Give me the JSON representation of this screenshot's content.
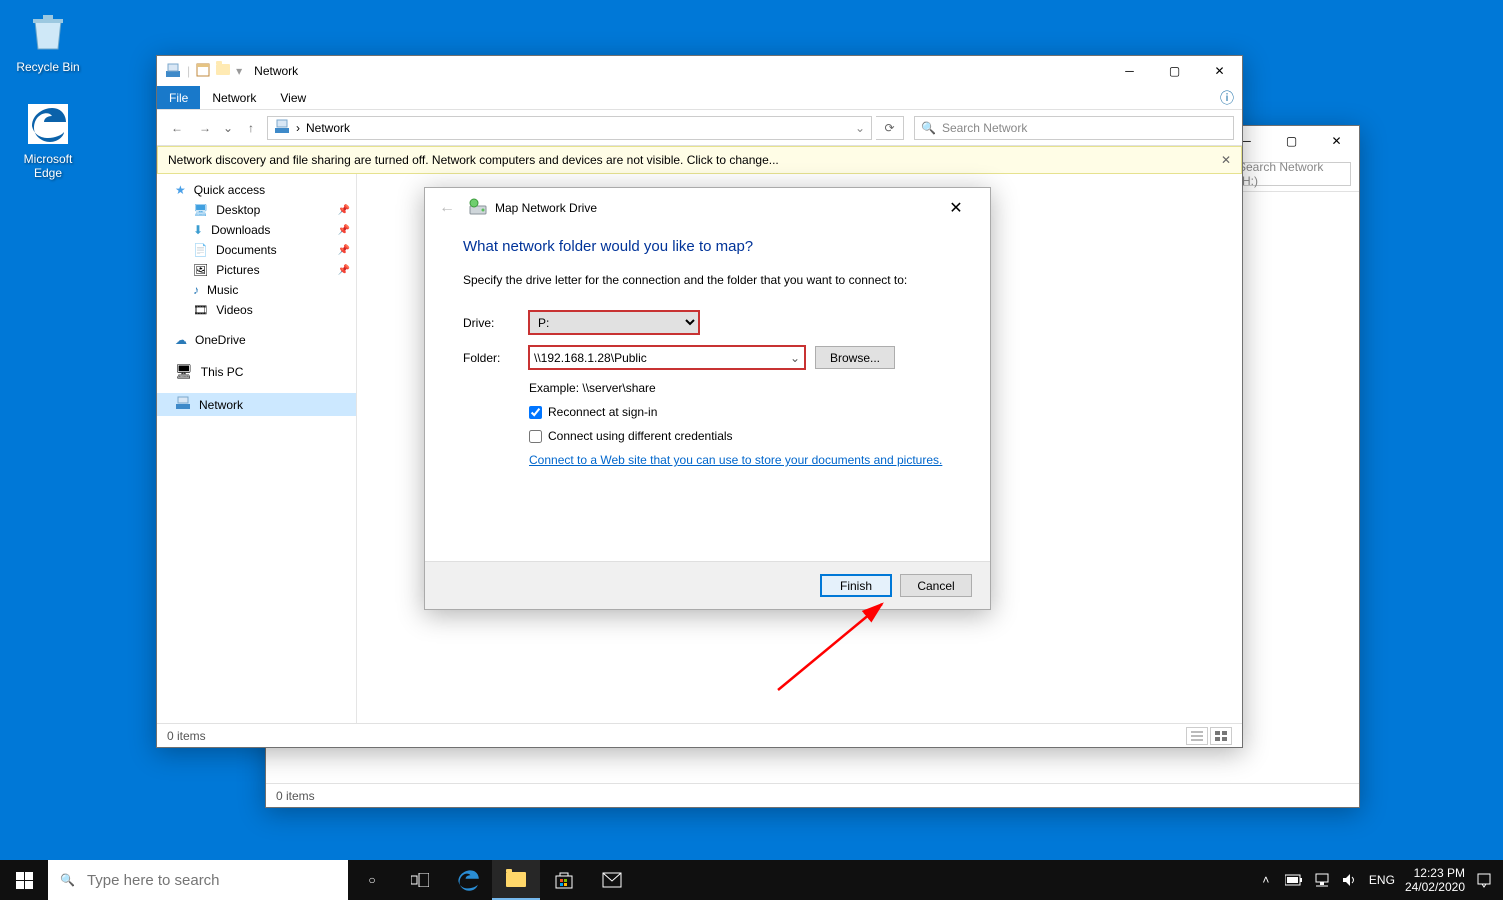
{
  "desktop": {
    "recycle": "Recycle Bin",
    "edge": "Microsoft Edge"
  },
  "explorerBack": {
    "searchPlaceholder": "Search Network (H:)"
  },
  "explorer": {
    "title": "Network",
    "tabs": {
      "file": "File",
      "network": "Network",
      "view": "View"
    },
    "addr": "Network",
    "searchPlaceholder": "Search Network",
    "infobar": "Network discovery and file sharing are turned off. Network computers and devices are not visible. Click to change...",
    "nav": {
      "quick": "Quick access",
      "desktop": "Desktop",
      "downloads": "Downloads",
      "documents": "Documents",
      "pictures": "Pictures",
      "music": "Music",
      "videos": "Videos",
      "onedrive": "OneDrive",
      "thispc": "This PC",
      "network": "Network"
    },
    "status": "0 items"
  },
  "dialog": {
    "title": "Map Network Drive",
    "heading": "What network folder would you like to map?",
    "instruction": "Specify the drive letter for the connection and the folder that you want to connect to:",
    "driveLabel": "Drive:",
    "driveValue": "P:",
    "folderLabel": "Folder:",
    "folderValue": "\\\\192.168.1.28\\Public",
    "browse": "Browse...",
    "example": "Example: \\\\server\\share",
    "reconnect": "Reconnect at sign-in",
    "diffcred": "Connect using different credentials",
    "link": "Connect to a Web site that you can use to store your documents and pictures.",
    "finish": "Finish",
    "cancel": "Cancel"
  },
  "taskbar": {
    "searchPlaceholder": "Type here to search",
    "lang": "ENG",
    "time": "12:23 PM",
    "date": "24/02/2020"
  }
}
